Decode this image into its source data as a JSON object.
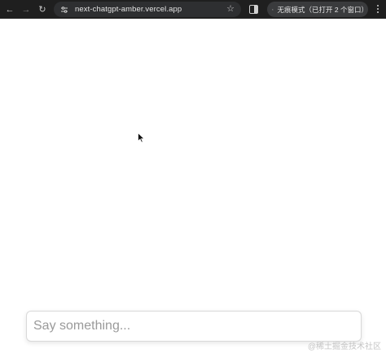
{
  "browser": {
    "url": "next-chatgpt-amber.vercel.app",
    "incognito_label": "无痕模式（已打开 2 个窗口）"
  },
  "chat": {
    "placeholder": "Say something...",
    "value": ""
  },
  "watermark": "@稀土掘金技术社区",
  "icons": {
    "back": "arrow-left-icon",
    "forward": "arrow-right-icon",
    "reload": "reload-icon",
    "site_info": "tune-icon",
    "bookmark": "star-icon",
    "side_panel": "side-panel-icon",
    "incognito": "incognito-icon",
    "menu": "kebab-menu-icon"
  }
}
